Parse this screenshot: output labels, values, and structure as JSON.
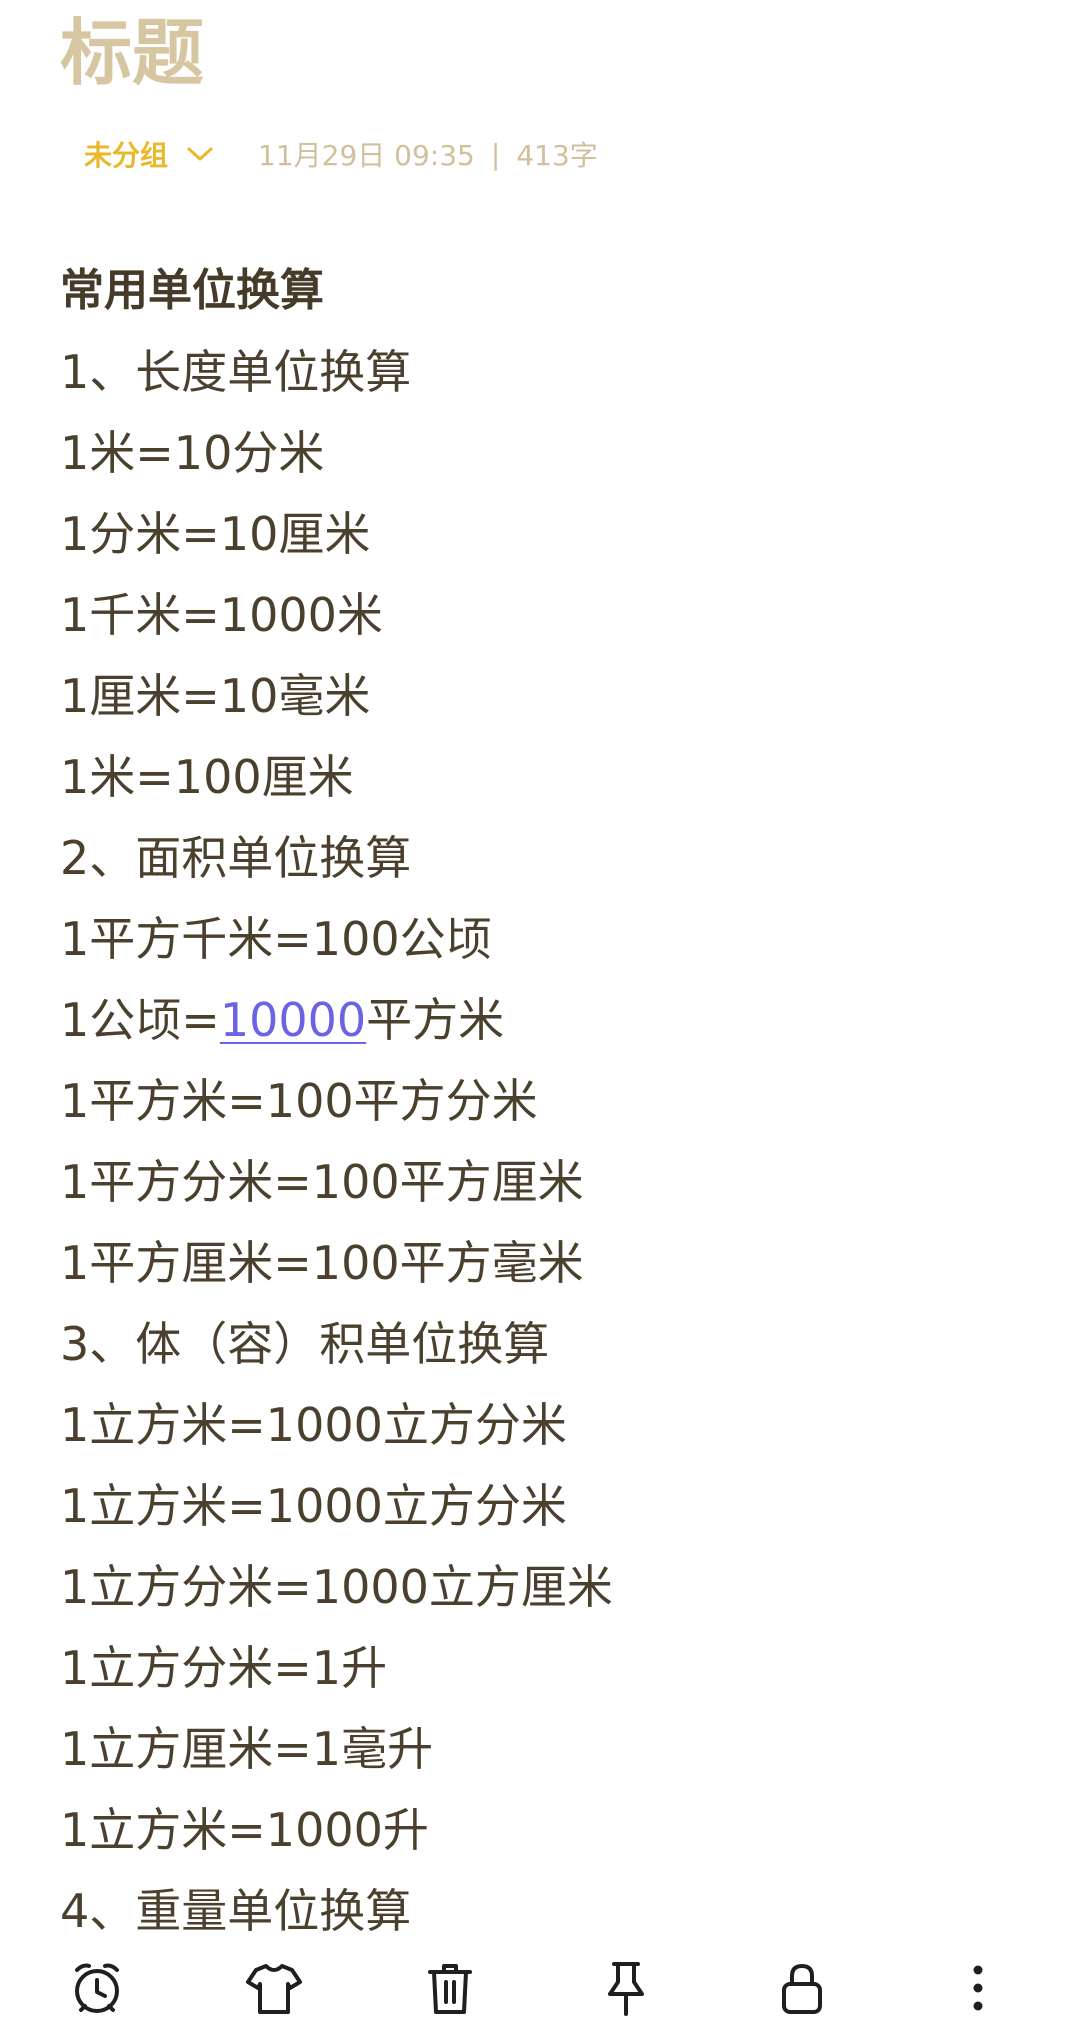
{
  "note": {
    "title": "标题",
    "group": "未分组",
    "datetime": "11月29日 09:35",
    "separator": "|",
    "word_count": "413字"
  },
  "content": {
    "heading": "常用单位换算",
    "l1": "1、长度单位换算",
    "l2": "1米=10分米",
    "l3": "1分米=10厘米",
    "l4": "1千米=1000米",
    "l5": "1厘米=10毫米",
    "l6": "1米=100厘米",
    "l7": "2、面积单位换算",
    "l8": "1平方千米=100公顷",
    "l9a": "1公顷=",
    "l9link": "10000",
    "l9b": "平方米",
    "l10": "1平方米=100平方分米",
    "l11": "1平方分米=100平方厘米",
    "l12": "1平方厘米=100平方毫米",
    "l13": "3、体（容）积单位换算",
    "l14": "1立方米=1000立方分米",
    "l15": "1立方米=1000立方分米",
    "l16": "1立方分米=1000立方厘米",
    "l17": "1立方分米=1升",
    "l18": "1立方厘米=1毫升",
    "l19": "1立方米=1000升",
    "l20": "4、重量单位换算"
  },
  "toolbar": {
    "icons": [
      "alarm-clock-icon",
      "tshirt-icon",
      "trash-icon",
      "pin-icon",
      "lock-icon",
      "more-vertical-icon"
    ]
  },
  "colors": {
    "title": "#d7c6a2",
    "group": "#e9b92a",
    "meta": "#d2bf9b",
    "text": "#4b3f2d",
    "link": "#6b63e6"
  }
}
